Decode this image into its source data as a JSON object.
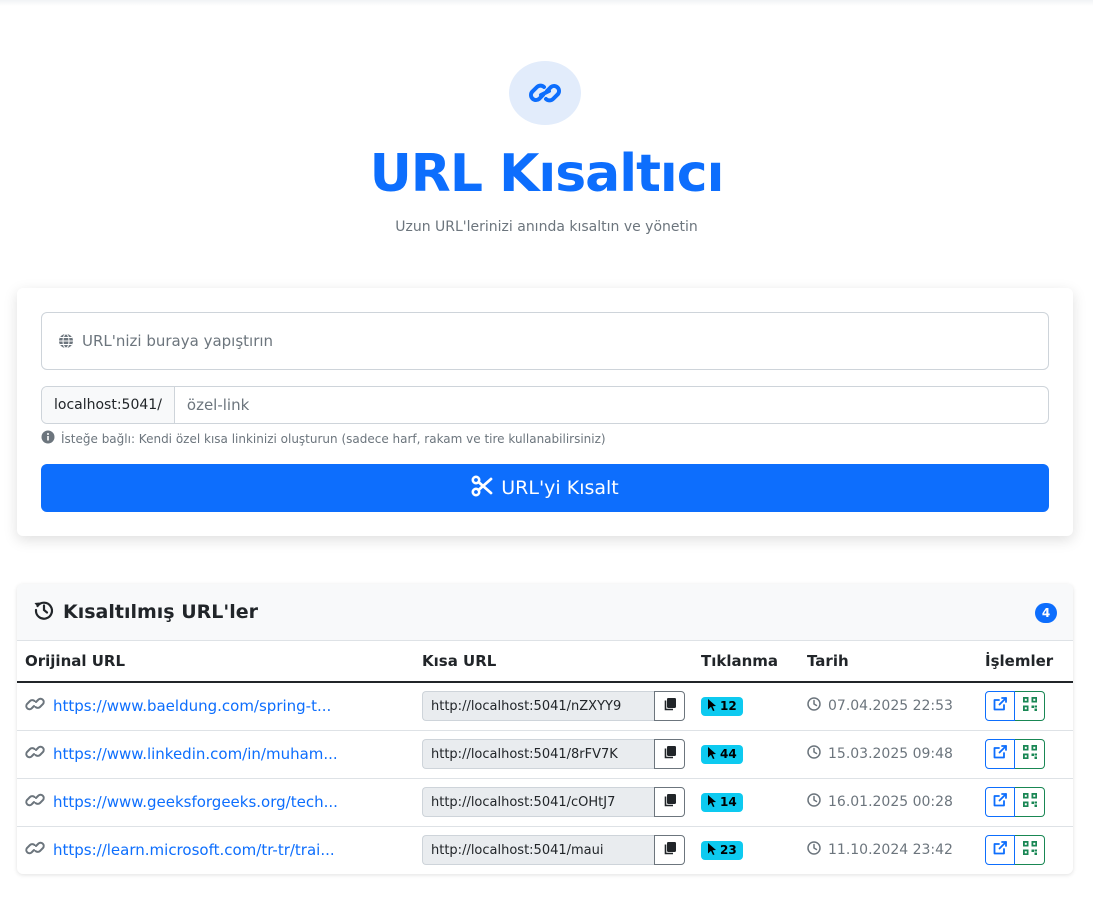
{
  "header": {
    "title": "URL Kısaltıcı",
    "subtitle": "Uzun URL'lerinizi anında kısaltın ve yönetin",
    "logo_icon": "link-icon"
  },
  "form": {
    "url_placeholder": "URL'nizi buraya yapıştırın",
    "alias_prefix": "localhost:5041/",
    "alias_placeholder": "özel-link",
    "hint": "İsteğe bağlı: Kendi özel kısa linkinizi oluşturun (sadece harf, rakam ve tire kullanabilirsiniz)",
    "submit_label": "URL'yi Kısalt"
  },
  "list": {
    "title": "Kısaltılmış URL'ler",
    "count": "4",
    "columns": [
      "Orijinal URL",
      "Kısa URL",
      "Tıklanma",
      "Tarih",
      "İşlemler"
    ],
    "rows": [
      {
        "original": "https://www.baeldung.com/spring-t...",
        "short": "http://localhost:5041/nZXYY9",
        "clicks": "12",
        "date": "07.04.2025 22:53"
      },
      {
        "original": "https://www.linkedin.com/in/muham...",
        "short": "http://localhost:5041/8rFV7K",
        "clicks": "44",
        "date": "15.03.2025 09:48"
      },
      {
        "original": "https://www.geeksforgeeks.org/tech...",
        "short": "http://localhost:5041/cOHtJ7",
        "clicks": "14",
        "date": "16.01.2025 00:28"
      },
      {
        "original": "https://learn.microsoft.com/tr-tr/trai...",
        "short": "http://localhost:5041/maui",
        "clicks": "23",
        "date": "11.10.2024 23:42"
      }
    ]
  },
  "colors": {
    "primary": "#0d6efd",
    "info": "#0dcaf0",
    "success": "#198754",
    "muted": "#6c757d"
  }
}
